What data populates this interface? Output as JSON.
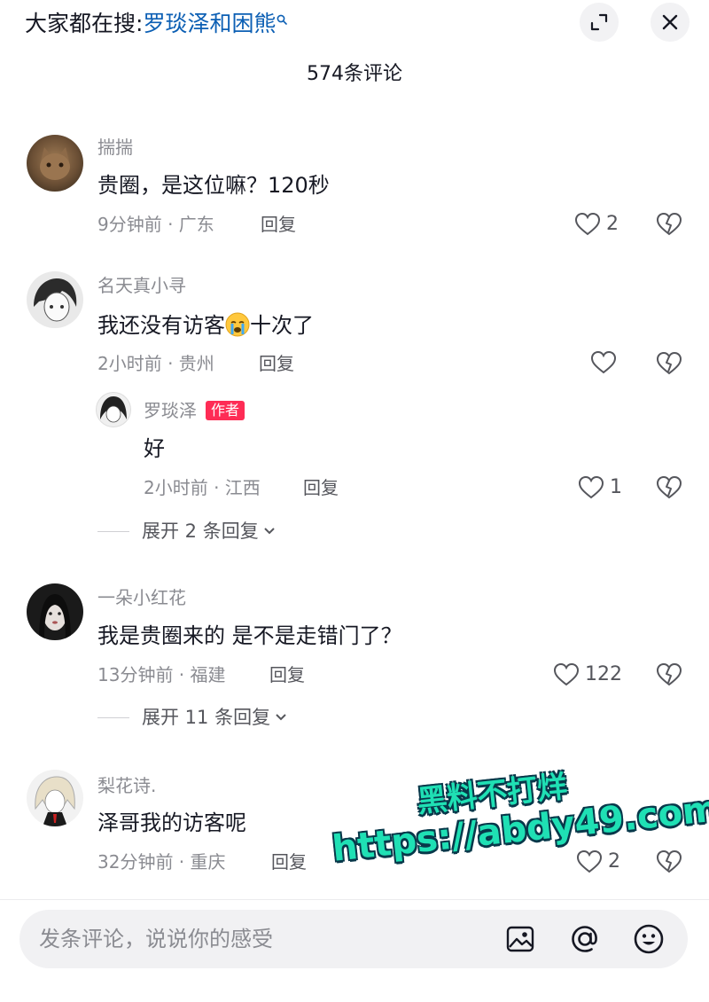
{
  "header": {
    "prefix": "大家都在搜:",
    "keyword": "罗琰泽和困熊",
    "expand_icon": "expand-icon",
    "close_icon": "close-icon"
  },
  "comment_count": "574条评论",
  "comments": [
    {
      "user": "揣揣",
      "text": "贵圈，是这位嘛？120秒",
      "time": "9分钟前 · 广东",
      "reply": "回复",
      "likes": "2"
    },
    {
      "user": "名天真小寻",
      "text_before": "我还没有访客",
      "emoji": "crying-face",
      "text_after": "十次了",
      "time": "2小时前 · 贵州",
      "reply": "回复",
      "likes": "",
      "sub_reply": {
        "user": "罗琰泽",
        "badge": "作者",
        "text": "好",
        "time": "2小时前 · 江西",
        "reply": "回复",
        "likes": "1"
      },
      "expand": "展开 2 条回复"
    },
    {
      "user": "一朵小红花",
      "text": "我是贵圈来的 是不是走错门了？",
      "time": "13分钟前 · 福建",
      "reply": "回复",
      "likes": "122",
      "expand": "展开 11 条回复"
    },
    {
      "user": "梨花诗.",
      "text": "泽哥我的访客呢",
      "time": "32分钟前 · 重庆",
      "reply": "回复",
      "likes": "2"
    }
  ],
  "watermark": {
    "line1": "黑料不打烊",
    "line2": "https://abdy49.com"
  },
  "input": {
    "placeholder": "发条评论，说说你的感受",
    "icons": [
      "image-icon",
      "at-icon",
      "emoji-icon"
    ]
  },
  "colors": {
    "keyword": "#0c5fb4",
    "badge": "#fe2c55",
    "watermark": "#1fe0b4"
  }
}
